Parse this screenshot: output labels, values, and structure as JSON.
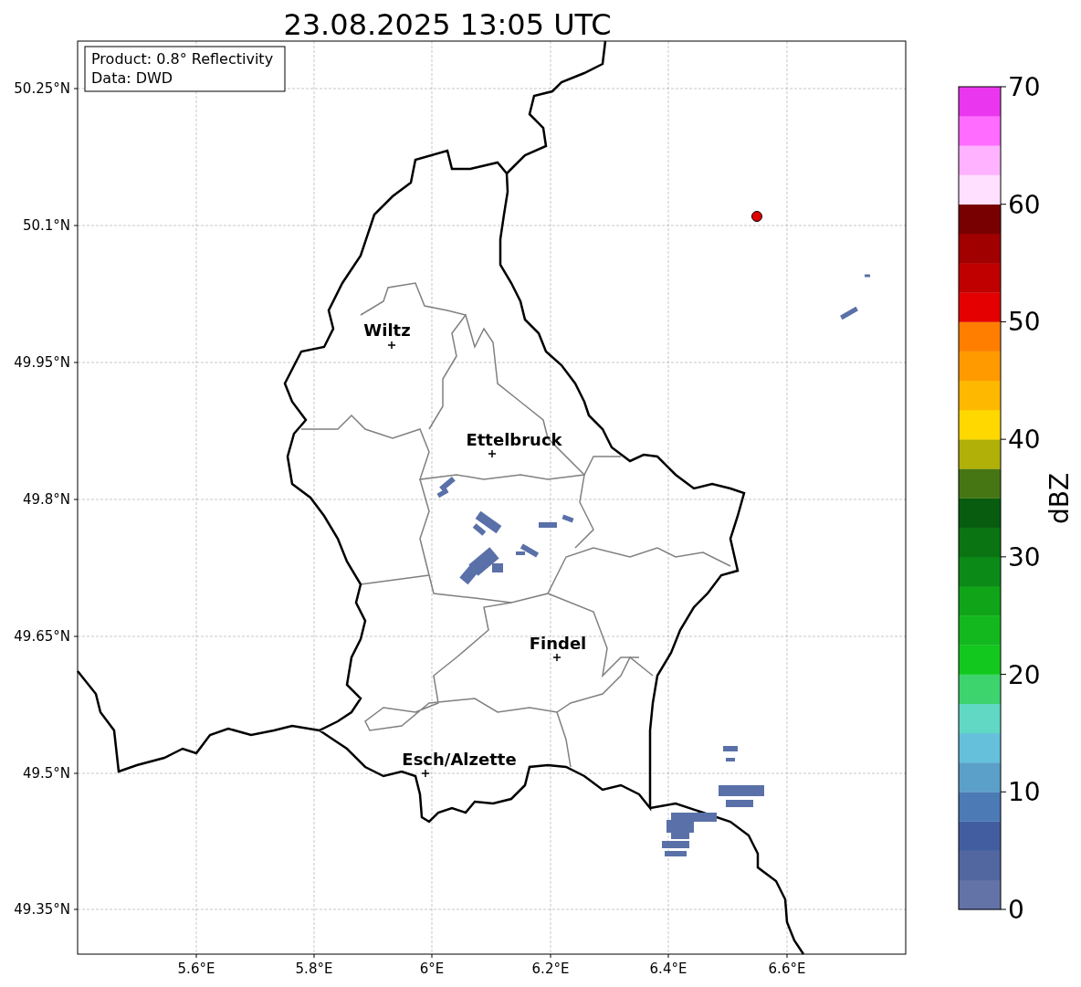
{
  "title": "23.08.2025 13:05 UTC",
  "info_box": [
    "Product: 0.8° Reflectivity",
    "Data: DWD"
  ],
  "y_ticks": [
    "50.25°N",
    "50.1°N",
    "49.95°N",
    "49.8°N",
    "49.65°N",
    "49.5°N",
    "49.35°N"
  ],
  "x_ticks": [
    "5.6°E",
    "5.8°E",
    "6°E",
    "6.2°E",
    "6.4°E",
    "6.6°E"
  ],
  "cities": [
    {
      "name": "Wiltz"
    },
    {
      "name": "Ettelbruck"
    },
    {
      "name": "Findel"
    },
    {
      "name": "Esch/Alzette"
    }
  ],
  "colorbar": {
    "label": "dBZ",
    "ticks": [
      "70",
      "60",
      "50",
      "40",
      "30",
      "20",
      "10",
      "0"
    ],
    "segments": [
      {
        "color": "#6373a8"
      },
      {
        "color": "#5266a0"
      },
      {
        "color": "#435ea0"
      },
      {
        "color": "#4b7ab4"
      },
      {
        "color": "#5ba0c8"
      },
      {
        "color": "#65c0dc"
      },
      {
        "color": "#60d8c4"
      },
      {
        "color": "#3dd46e"
      },
      {
        "color": "#12c81e"
      },
      {
        "color": "#12b81e"
      },
      {
        "color": "#10a418"
      },
      {
        "color": "#0c8a18"
      },
      {
        "color": "#0a7412"
      },
      {
        "color": "#075c10"
      },
      {
        "color": "#467614"
      },
      {
        "color": "#b0b008"
      },
      {
        "color": "#ffd800"
      },
      {
        "color": "#ffb800"
      },
      {
        "color": "#ff9a00"
      },
      {
        "color": "#ff7e00"
      },
      {
        "color": "#e40000"
      },
      {
        "color": "#c00000"
      },
      {
        "color": "#a00000"
      },
      {
        "color": "#780000"
      },
      {
        "color": "#ffe0ff"
      },
      {
        "color": "#ffb2ff"
      },
      {
        "color": "#ff6cff"
      },
      {
        "color": "#ea36ee"
      }
    ]
  }
}
